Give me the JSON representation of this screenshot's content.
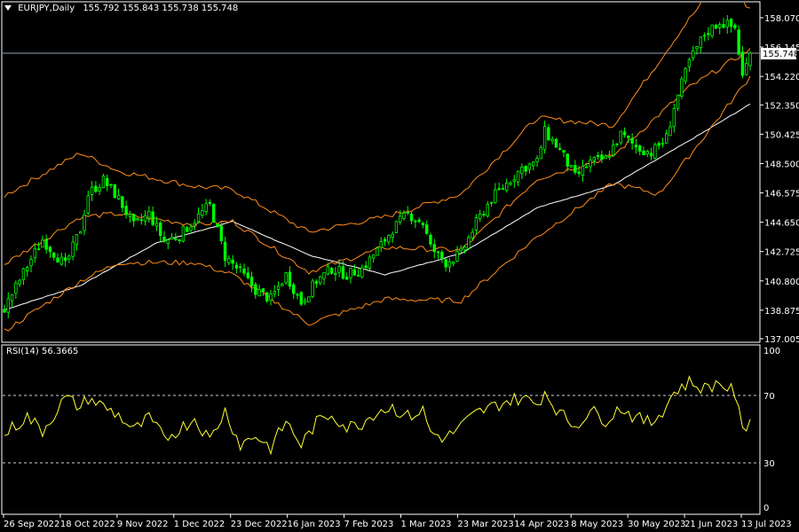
{
  "header": {
    "symbol": "EURJPY,Daily",
    "ohlc": "155.792 155.843 155.738 155.748",
    "menu_icon": "triangle-down-icon"
  },
  "price_badge": "155.748",
  "colors": {
    "background": "#000000",
    "frame": "#ffffff",
    "candle": "#00ff00",
    "bollinger": "#ff8c1a",
    "moving_average": "#ffffff",
    "rsi": "#ffff33",
    "price_line": "#8fa2b5"
  },
  "rsi_panel": {
    "label": "RSI(14) 56.3665"
  },
  "chart_data": [
    {
      "type": "candlestick",
      "title": "EURJPY,Daily",
      "ylim": [
        137.005,
        159.2
      ],
      "y_ticks": [
        "158.070",
        "156.145",
        "154.220",
        "152.350",
        "150.425",
        "148.500",
        "146.575",
        "144.650",
        "142.725",
        "140.800",
        "138.875",
        "137.005"
      ],
      "x_tick_labels": [
        "26 Sep 2022",
        "18 Oct 2022",
        "9 Nov 2022",
        "1 Dec 2022",
        "23 Dec 2022",
        "16 Jan 2023",
        "7 Feb 2023",
        "1 Mar 2023",
        "23 Mar 2023",
        "14 Apr 2023",
        "8 May 2023",
        "30 May 2023",
        "21 Jun 2023",
        "13 Jul 2023"
      ],
      "current_price": 155.748,
      "close_path": [
        [
          0,
          139.0
        ],
        [
          6,
          141.8
        ],
        [
          10,
          143.5
        ],
        [
          16,
          141.8
        ],
        [
          20,
          144.2
        ],
        [
          22,
          146.5
        ],
        [
          26,
          147.4
        ],
        [
          30,
          146.2
        ],
        [
          34,
          144.4
        ],
        [
          38,
          145.2
        ],
        [
          42,
          143.4
        ],
        [
          46,
          143.8
        ],
        [
          50,
          144.8
        ],
        [
          54,
          145.8
        ],
        [
          58,
          142.4
        ],
        [
          62,
          141.4
        ],
        [
          66,
          140.2
        ],
        [
          70,
          139.6
        ],
        [
          74,
          141.2
        ],
        [
          78,
          139.4
        ],
        [
          82,
          140.8
        ],
        [
          86,
          141.6
        ],
        [
          90,
          141.2
        ],
        [
          94,
          141.6
        ],
        [
          98,
          142.8
        ],
        [
          102,
          144.2
        ],
        [
          106,
          145.2
        ],
        [
          110,
          144.6
        ],
        [
          112,
          143.0
        ],
        [
          116,
          142.0
        ],
        [
          120,
          142.6
        ],
        [
          124,
          144.6
        ],
        [
          128,
          146.2
        ],
        [
          132,
          147.2
        ],
        [
          136,
          148.2
        ],
        [
          140,
          148.6
        ],
        [
          142,
          150.6
        ],
        [
          146,
          149.4
        ],
        [
          150,
          147.6
        ],
        [
          154,
          148.6
        ],
        [
          158,
          148.8
        ],
        [
          162,
          150.4
        ],
        [
          166,
          149.6
        ],
        [
          170,
          149.2
        ],
        [
          174,
          150.2
        ],
        [
          176,
          152.2
        ],
        [
          180,
          155.2
        ],
        [
          184,
          157.0
        ],
        [
          188,
          157.8
        ],
        [
          192,
          157.4
        ],
        [
          194,
          154.2
        ],
        [
          196,
          155.748
        ]
      ],
      "series": [
        {
          "name": "Moving Average",
          "values": [
            [
              0,
              138.9
            ],
            [
              20,
              140.5
            ],
            [
              40,
              143.3
            ],
            [
              60,
              144.7
            ],
            [
              80,
              142.5
            ],
            [
              100,
              141.2
            ],
            [
              120,
              142.6
            ],
            [
              140,
              145.6
            ],
            [
              160,
              147.1
            ],
            [
              180,
              150.0
            ],
            [
              196,
              152.4
            ]
          ]
        },
        {
          "name": "Bollinger Upper",
          "values": [
            [
              0,
              146.4
            ],
            [
              20,
              149.2
            ],
            [
              30,
              148.0
            ],
            [
              50,
              147.0
            ],
            [
              60,
              146.8
            ],
            [
              80,
              144.0
            ],
            [
              100,
              145.0
            ],
            [
              120,
              146.5
            ],
            [
              140,
              151.5
            ],
            [
              160,
              151.0
            ],
            [
              180,
              158.0
            ],
            [
              188,
              160.4
            ],
            [
              196,
              158.7
            ]
          ]
        },
        {
          "name": "Bollinger Middle",
          "values": [
            [
              0,
              141.9
            ],
            [
              20,
              145.0
            ],
            [
              30,
              145.2
            ],
            [
              50,
              144.5
            ],
            [
              60,
              144.7
            ],
            [
              80,
              141.4
            ],
            [
              100,
              143.0
            ],
            [
              120,
              142.8
            ],
            [
              140,
              147.5
            ],
            [
              160,
              149.0
            ],
            [
              180,
              153.5
            ],
            [
              196,
              156.0
            ]
          ]
        },
        {
          "name": "Bollinger Lower",
          "values": [
            [
              0,
              137.5
            ],
            [
              20,
              140.8
            ],
            [
              30,
              142.0
            ],
            [
              50,
              142.0
            ],
            [
              60,
              141.2
            ],
            [
              80,
              138.0
            ],
            [
              100,
              139.6
            ],
            [
              120,
              139.5
            ],
            [
              140,
              143.7
            ],
            [
              160,
              147.2
            ],
            [
              172,
              146.5
            ],
            [
              180,
              149.0
            ],
            [
              196,
              154.2
            ]
          ]
        }
      ]
    },
    {
      "type": "line",
      "title": "RSI(14) 56.3665",
      "ylim": [
        0,
        100
      ],
      "y_ticks": [
        100,
        70,
        30,
        0
      ],
      "levels": [
        70,
        30
      ],
      "series": [
        {
          "name": "RSI(14)",
          "values": [
            [
              0,
              47
            ],
            [
              6,
              58
            ],
            [
              10,
              49
            ],
            [
              16,
              70
            ],
            [
              20,
              64
            ],
            [
              22,
              70
            ],
            [
              30,
              59
            ],
            [
              34,
              49
            ],
            [
              38,
              57
            ],
            [
              42,
              44
            ],
            [
              46,
              50
            ],
            [
              50,
              57
            ],
            [
              54,
              43
            ],
            [
              58,
              62
            ],
            [
              62,
              40
            ],
            [
              66,
              46
            ],
            [
              70,
              38
            ],
            [
              74,
              55
            ],
            [
              78,
              40
            ],
            [
              82,
              54
            ],
            [
              86,
              60
            ],
            [
              90,
              51
            ],
            [
              94,
              54
            ],
            [
              98,
              62
            ],
            [
              102,
              64
            ],
            [
              106,
              58
            ],
            [
              110,
              62
            ],
            [
              112,
              48
            ],
            [
              116,
              44
            ],
            [
              120,
              52
            ],
            [
              124,
              60
            ],
            [
              128,
              64
            ],
            [
              132,
              68
            ],
            [
              136,
              70
            ],
            [
              140,
              66
            ],
            [
              142,
              74
            ],
            [
              146,
              60
            ],
            [
              150,
              52
            ],
            [
              154,
              62
            ],
            [
              158,
              56
            ],
            [
              162,
              64
            ],
            [
              166,
              57
            ],
            [
              170,
              54
            ],
            [
              174,
              65
            ],
            [
              176,
              74
            ],
            [
              180,
              80
            ],
            [
              184,
              76
            ],
            [
              188,
              80
            ],
            [
              192,
              73
            ],
            [
              194,
              48
            ],
            [
              196,
              56.3665
            ]
          ]
        }
      ]
    }
  ]
}
